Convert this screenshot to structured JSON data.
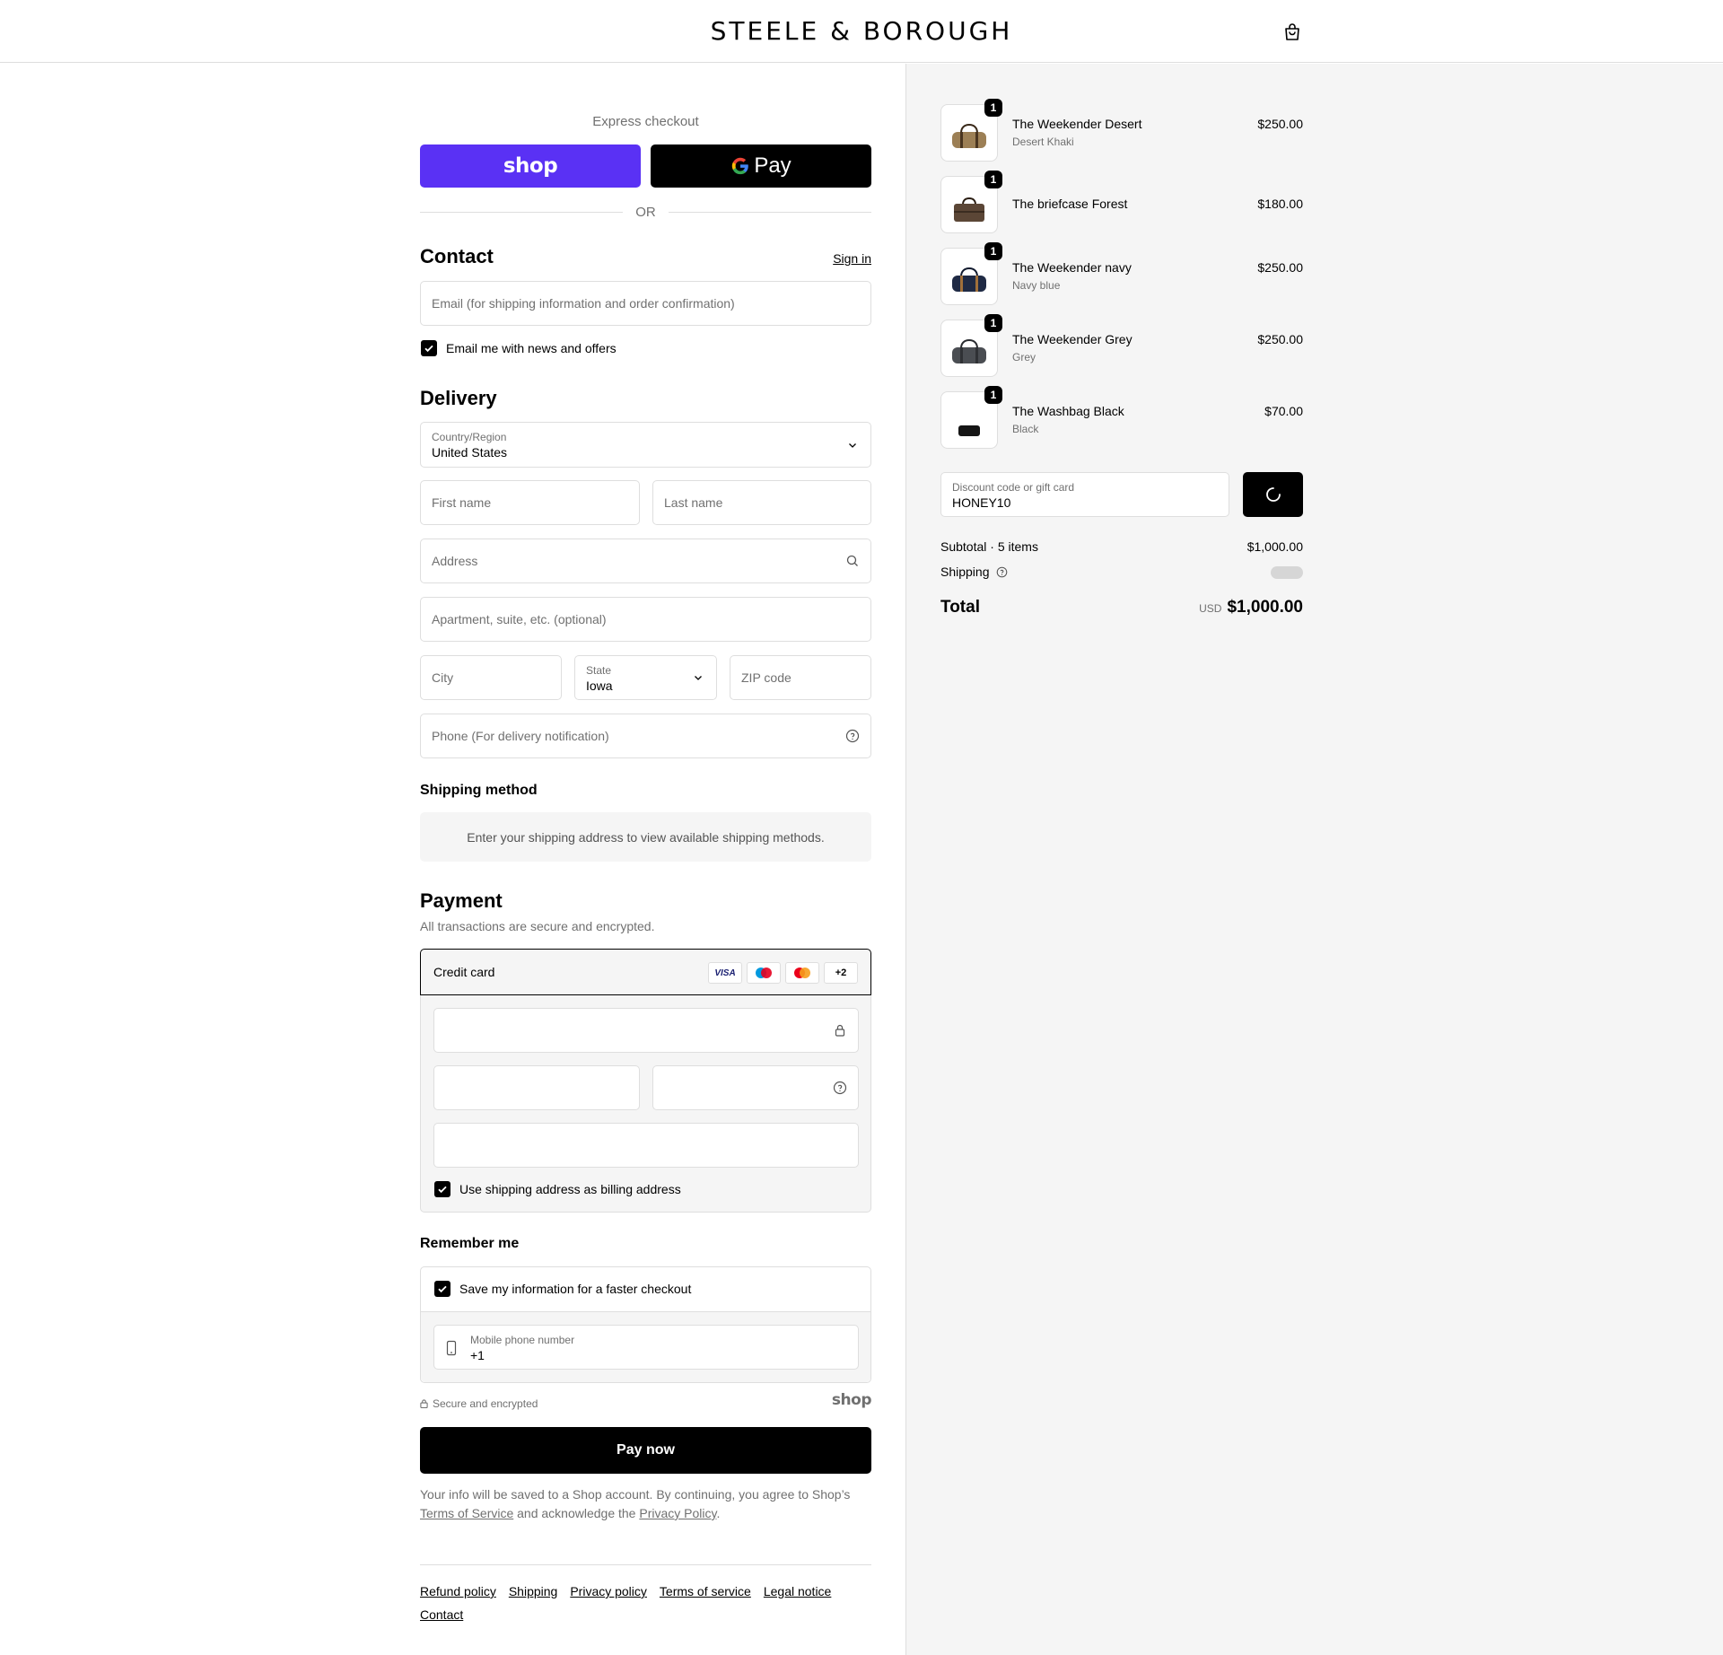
{
  "header": {
    "brand": "STEELE & BOROUGH",
    "cart_icon": "shopping-bag-icon"
  },
  "express": {
    "title": "Express checkout",
    "shop_label": "shop",
    "gpay_label": "Pay",
    "or": "OR"
  },
  "contact": {
    "title": "Contact",
    "sign_in": "Sign in",
    "email_placeholder": "Email (for shipping information and order confirmation)",
    "news_label": "Email me with news and offers",
    "news_checked": true
  },
  "delivery": {
    "title": "Delivery",
    "country_label": "Country/Region",
    "country_value": "United States",
    "first_name": "First name",
    "last_name": "Last name",
    "address": "Address",
    "apartment": "Apartment, suite, etc. (optional)",
    "city": "City",
    "state_label": "State",
    "state_value": "Iowa",
    "zip": "ZIP code",
    "phone": "Phone (For delivery notification)"
  },
  "shipping_method": {
    "title": "Shipping method",
    "message": "Enter your shipping address to view available shipping methods."
  },
  "payment": {
    "title": "Payment",
    "subtitle": "All transactions are secure and encrypted.",
    "method": "Credit card",
    "cards": [
      "VISA",
      "maestro",
      "mastercard",
      "+2"
    ],
    "billing_label": "Use shipping address as billing address",
    "billing_checked": true
  },
  "remember": {
    "title": "Remember me",
    "save_label": "Save my information for a faster checkout",
    "phone_label": "Mobile phone number",
    "phone_value": "+1"
  },
  "secure_text": "Secure and encrypted",
  "shop_small": "shop",
  "pay_now": "Pay now",
  "legal": {
    "text1": "Your info will be saved to a Shop account. By continuing, you agree to Shop’s",
    "terms": "Terms of Service",
    "text2": "and acknowledge the",
    "privacy": "Privacy Policy",
    "text3": "."
  },
  "footer_links": [
    "Refund policy",
    "Shipping",
    "Privacy policy",
    "Terms of service",
    "Legal notice",
    "Contact"
  ],
  "order": {
    "items": [
      {
        "name": "The Weekender Desert",
        "variant": "Desert Khaki",
        "price": "$250.00",
        "qty": "1",
        "color": "#9c7f55"
      },
      {
        "name": "The briefcase Forest",
        "variant": "",
        "price": "$180.00",
        "qty": "1",
        "color": "#5b4636"
      },
      {
        "name": "The Weekender navy",
        "variant": "Navy blue",
        "price": "$250.00",
        "qty": "1",
        "color": "#1f2a44"
      },
      {
        "name": "The Weekender Grey",
        "variant": "Grey",
        "price": "$250.00",
        "qty": "1",
        "color": "#4a4d52"
      },
      {
        "name": "The Washbag Black",
        "variant": "Black",
        "price": "$70.00",
        "qty": "1",
        "color": "#151515"
      }
    ],
    "discount_label": "Discount code or gift card",
    "discount_value": "HONEY10",
    "subtotal_label": "Subtotal · 5 items",
    "subtotal_value": "$1,000.00",
    "shipping_label": "Shipping",
    "total_label": "Total",
    "currency": "USD",
    "total_value": "$1,000.00"
  }
}
